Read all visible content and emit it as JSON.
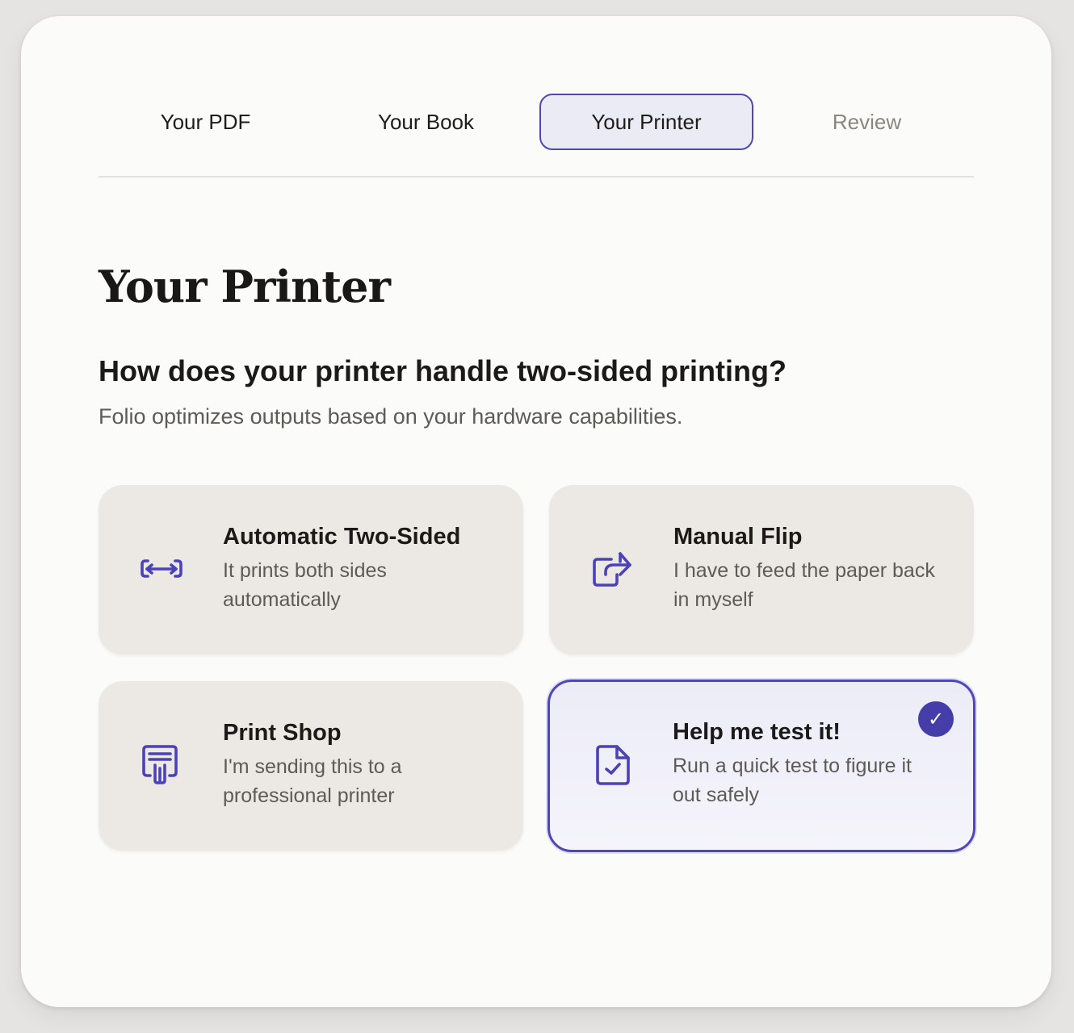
{
  "stepper": {
    "steps": [
      {
        "label": "Your PDF",
        "state": "complete"
      },
      {
        "label": "Your Book",
        "state": "complete"
      },
      {
        "label": "Your Printer",
        "state": "active"
      },
      {
        "label": "Review",
        "state": "upcoming"
      }
    ]
  },
  "page": {
    "title": "Your Printer",
    "question": "How does your printer handle two-sided printing?",
    "subtitle": "Folio optimizes outputs based on your hardware capabilities."
  },
  "options": [
    {
      "title": "Automatic Two-Sided",
      "description": "It prints both sides automatically",
      "icon": "duplex-arrows-icon",
      "selected": false
    },
    {
      "title": "Manual Flip",
      "description": "I have to feed the paper back in myself",
      "icon": "share-arrow-icon",
      "selected": false
    },
    {
      "title": "Print Shop",
      "description": "I'm sending this to a professional printer",
      "icon": "print-shop-icon",
      "selected": false
    },
    {
      "title": "Help me test it!",
      "description": "Run a quick test to figure it out safely",
      "icon": "file-check-icon",
      "selected": true
    }
  ],
  "selection_check": "✓",
  "colors": {
    "accent": "#4f47b8",
    "card_background": "#ece9e4",
    "selected_background": "#ececf8",
    "text": "#1c1a18",
    "muted_text": "#5e5a55"
  }
}
